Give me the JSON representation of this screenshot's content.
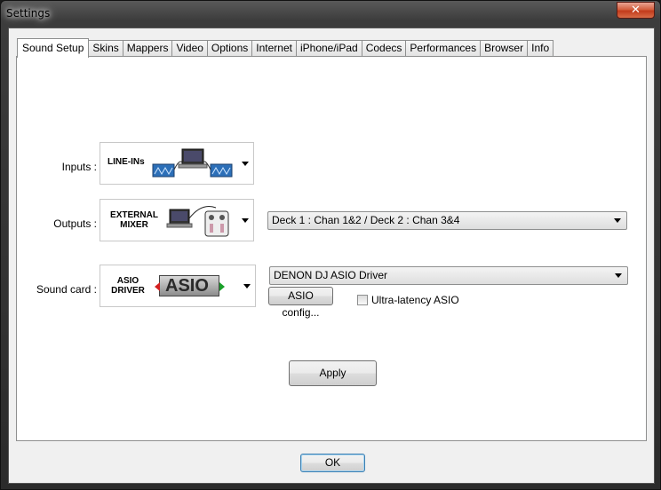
{
  "window": {
    "title": "Settings",
    "close_glyph": "✕"
  },
  "tabs": [
    {
      "label": "Sound Setup",
      "active": true
    },
    {
      "label": "Skins"
    },
    {
      "label": "Mappers"
    },
    {
      "label": "Video"
    },
    {
      "label": "Options"
    },
    {
      "label": "Internet"
    },
    {
      "label": "iPhone/iPad"
    },
    {
      "label": "Codecs"
    },
    {
      "label": "Performances"
    },
    {
      "label": "Browser"
    },
    {
      "label": "Info"
    }
  ],
  "sound_setup": {
    "inputs": {
      "label": "Inputs :",
      "image_caption": "LINE-INs"
    },
    "outputs": {
      "label": "Outputs :",
      "image_caption_line1": "EXTERNAL",
      "image_caption_line2": "MIXER",
      "routing_value": "Deck 1 : Chan 1&2 / Deck 2 : Chan 3&4"
    },
    "sound_card": {
      "label": "Sound card :",
      "image_caption_line1": "ASIO",
      "image_caption_line2": "DRIVER",
      "logo_text": "ASIO",
      "driver_value": "DENON DJ ASIO Driver",
      "config_button": "ASIO config...",
      "ultra_latency_label": "Ultra-latency ASIO",
      "ultra_latency_checked": false
    },
    "apply_button": "Apply"
  },
  "ok_button": "OK",
  "colors": {
    "accent": "#3c7fb1",
    "close_red": "#c23b1c",
    "asio_arrow_red": "#d42020",
    "asio_arrow_green": "#1aa02a"
  }
}
